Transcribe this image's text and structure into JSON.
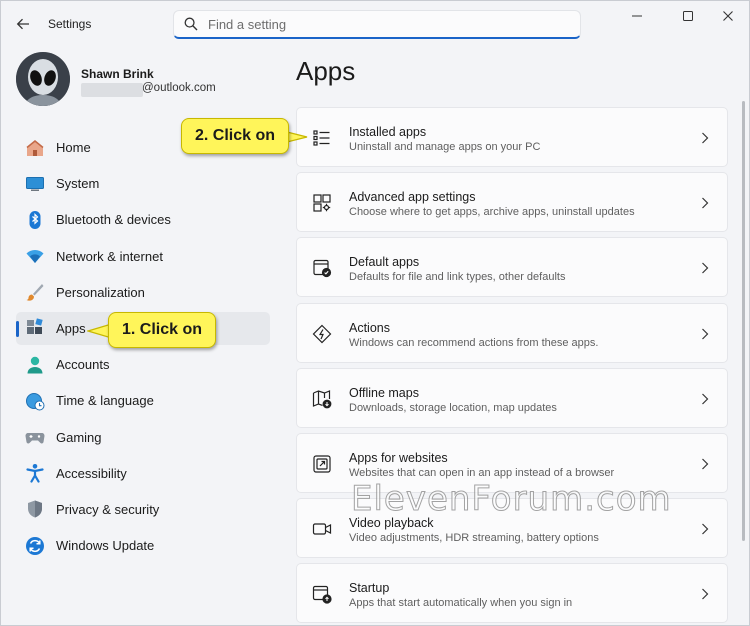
{
  "window": {
    "title": "Settings",
    "controls": {
      "minimize": "minimize-icon",
      "maximize": "maximize-icon",
      "close": "close-icon"
    }
  },
  "search": {
    "placeholder": "Find a setting",
    "value": ""
  },
  "profile": {
    "name": "Shawn Brink",
    "email_suffix": "@outlook.com"
  },
  "sidebar": {
    "items": [
      {
        "label": "Home",
        "icon": "home-icon",
        "selected": false
      },
      {
        "label": "System",
        "icon": "system-icon",
        "selected": false
      },
      {
        "label": "Bluetooth & devices",
        "icon": "bluetooth-icon",
        "selected": false
      },
      {
        "label": "Network & internet",
        "icon": "wifi-icon",
        "selected": false
      },
      {
        "label": "Personalization",
        "icon": "brush-icon",
        "selected": false
      },
      {
        "label": "Apps",
        "icon": "apps-icon",
        "selected": true
      },
      {
        "label": "Accounts",
        "icon": "accounts-icon",
        "selected": false
      },
      {
        "label": "Time & language",
        "icon": "time-language-icon",
        "selected": false
      },
      {
        "label": "Gaming",
        "icon": "gamepad-icon",
        "selected": false
      },
      {
        "label": "Accessibility",
        "icon": "accessibility-icon",
        "selected": false
      },
      {
        "label": "Privacy & security",
        "icon": "shield-icon",
        "selected": false
      },
      {
        "label": "Windows Update",
        "icon": "windows-update-icon",
        "selected": false
      }
    ]
  },
  "main": {
    "title": "Apps",
    "items": [
      {
        "title": "Installed apps",
        "description": "Uninstall and manage apps on your PC",
        "icon": "installed-apps-icon"
      },
      {
        "title": "Advanced app settings",
        "description": "Choose where to get apps, archive apps, uninstall updates",
        "icon": "advanced-app-settings-icon"
      },
      {
        "title": "Default apps",
        "description": "Defaults for file and link types, other defaults",
        "icon": "default-apps-icon"
      },
      {
        "title": "Actions",
        "description": "Windows can recommend actions from these apps.",
        "icon": "actions-icon"
      },
      {
        "title": "Offline maps",
        "description": "Downloads, storage location, map updates",
        "icon": "offline-maps-icon"
      },
      {
        "title": "Apps for websites",
        "description": "Websites that can open in an app instead of a browser",
        "icon": "apps-for-websites-icon"
      },
      {
        "title": "Video playback",
        "description": "Video adjustments, HDR streaming, battery options",
        "icon": "video-playback-icon"
      },
      {
        "title": "Startup",
        "description": "Apps that start automatically when you sign in",
        "icon": "startup-icon"
      }
    ]
  },
  "annotations": {
    "callout1": "1. Click on",
    "callout2": "2. Click on",
    "watermark": "ElevenForum.com"
  },
  "colors": {
    "accent": "#1a64c8",
    "callout_fill": "#fff55a",
    "background": "#f3f4f7",
    "card": "#fbfbfc"
  }
}
